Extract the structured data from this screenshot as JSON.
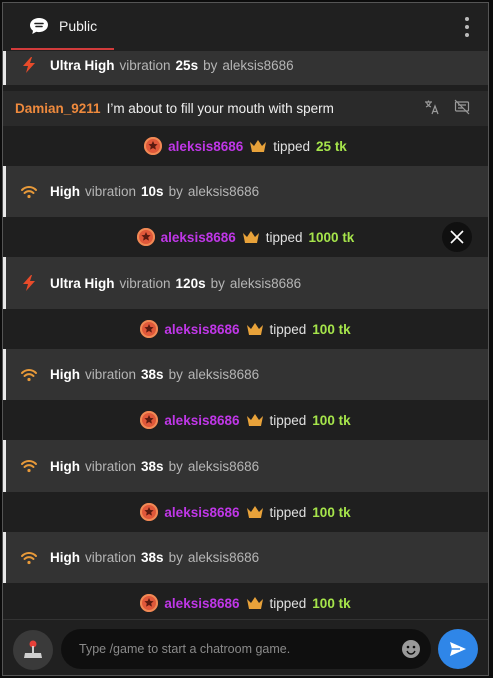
{
  "header": {
    "tab_label": "Public"
  },
  "vibration_rows": [
    {
      "level": "Ultra High",
      "word": "vibration",
      "duration": "25s",
      "by": "by",
      "user": "aleksis8686",
      "icon": "lightning-icon"
    },
    {
      "level": "High",
      "word": "vibration",
      "duration": "10s",
      "by": "by",
      "user": "aleksis8686",
      "icon": "wifi-icon"
    },
    {
      "level": "Ultra High",
      "word": "vibration",
      "duration": "120s",
      "by": "by",
      "user": "aleksis8686",
      "icon": "lightning-icon"
    },
    {
      "level": "High",
      "word": "vibration",
      "duration": "38s",
      "by": "by",
      "user": "aleksis8686",
      "icon": "wifi-icon"
    },
    {
      "level": "High",
      "word": "vibration",
      "duration": "38s",
      "by": "by",
      "user": "aleksis8686",
      "icon": "wifi-icon"
    },
    {
      "level": "High",
      "word": "vibration",
      "duration": "38s",
      "by": "by",
      "user": "aleksis8686",
      "icon": "wifi-icon"
    }
  ],
  "chat_message": {
    "user": "Damian_9211",
    "text": "I’m about to fill your mouth with sperm"
  },
  "tip_rows": [
    {
      "user": "aleksis8686",
      "verb": "tipped",
      "amount": "25 tk"
    },
    {
      "user": "aleksis8686",
      "verb": "tipped",
      "amount": "1000 tk"
    },
    {
      "user": "aleksis8686",
      "verb": "tipped",
      "amount": "100 tk"
    },
    {
      "user": "aleksis8686",
      "verb": "tipped",
      "amount": "100 tk"
    },
    {
      "user": "aleksis8686",
      "verb": "tipped",
      "amount": "100 tk"
    },
    {
      "user": "aleksis8686",
      "verb": "tipped",
      "amount": "100 tk"
    }
  ],
  "composer": {
    "placeholder": "Type /game to start a chatroom game."
  },
  "colors": {
    "accent": "#2f86e8",
    "tip_user": "#c037e8",
    "tip_amount": "#a6e54b",
    "chat_user": "#ef8a3d"
  }
}
